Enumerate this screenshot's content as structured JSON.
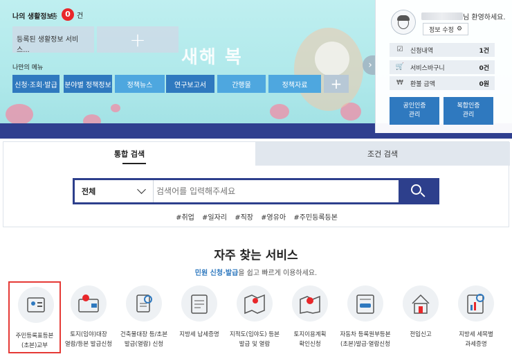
{
  "hero": {
    "banner_text": "새해 복",
    "my_life_info_label": "나의 생활정보",
    "total_label": "총",
    "total_count": "0",
    "count_unit": "건",
    "registered_card": "등록된 생활정보 서비스...",
    "my_menu_label": "나만의 메뉴",
    "menu_items": [
      "신청·조회·발급",
      "분야별 정책정보",
      "정책뉴스",
      "연구보고서",
      "간행물",
      "정책자료"
    ],
    "menu_add": "+",
    "card_add": "+"
  },
  "user": {
    "greeting_suffix": "님 환영하세요.",
    "edit_label": "정보 수정",
    "rows": [
      {
        "icon": "checklist-icon",
        "label": "신청내역",
        "value": "1건"
      },
      {
        "icon": "cart-icon",
        "label": "서비스바구니",
        "value": "0건"
      },
      {
        "icon": "won-icon",
        "label": "환불 금액",
        "value": "0원"
      }
    ],
    "cert_buttons": [
      "공인인증\n관리",
      "복합인증\n관리"
    ]
  },
  "search": {
    "tabs": [
      "통합 검색",
      "조건 검색"
    ],
    "select_value": "전체",
    "placeholder": "검색어를 입력해주세요",
    "tags": [
      "#취업",
      "#일자리",
      "#직장",
      "#영유아",
      "#주민등록등본"
    ]
  },
  "frequent": {
    "title": "자주 찾는 서비스",
    "subtitle_hl": "민원 신청·발급",
    "subtitle_rest": "을 쉽고 빠르게 이용하세요.",
    "items": [
      {
        "icon": "id-card-icon",
        "label": "주민등록표등본\n(초본)교부"
      },
      {
        "icon": "land-register-icon",
        "label": "토지(임야)대장\n열람/등본 발급신청"
      },
      {
        "icon": "building-register-icon",
        "label": "건축물대장 등/초본\n발급(열람) 신청"
      },
      {
        "icon": "tax-document-icon",
        "label": "지방세 납세증명"
      },
      {
        "icon": "cadastral-map-icon",
        "label": "지적도(임야도) 등본\n발급 및 열람"
      },
      {
        "icon": "land-use-plan-icon",
        "label": "토지이용계획\n확인신청"
      },
      {
        "icon": "car-register-icon",
        "label": "자동차 등록원부등본\n(초본)발급·열람신청"
      },
      {
        "icon": "move-in-report-icon",
        "label": "전입신고"
      },
      {
        "icon": "tax-list-icon",
        "label": "지방세 세목별\n과세증명"
      }
    ]
  }
}
